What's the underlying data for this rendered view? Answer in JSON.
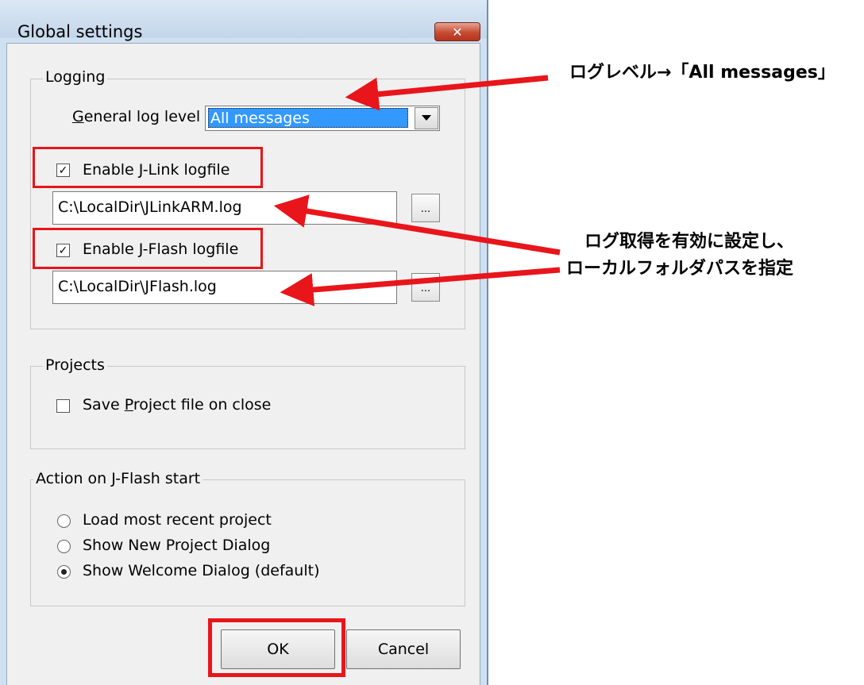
{
  "dialog": {
    "title": "Global settings",
    "close_glyph": "✕"
  },
  "logging": {
    "group_label": "Logging",
    "log_level_label_prefix": "G",
    "log_level_label_rest": "eneral log level",
    "log_level_value": "All messages",
    "jlink_checkbox": {
      "checked": true,
      "label_prefix": "Enable ",
      "label_access": "J",
      "label_rest": "-Link logfile"
    },
    "jlink_path": "C:\\LocalDir\\JLinkARM.log",
    "jflash_checkbox": {
      "checked": true,
      "label": "Enable J-Flash logfile"
    },
    "jflash_path": "C:\\LocalDir\\JFlash.log",
    "browse_label": "..."
  },
  "projects": {
    "group_label": "Projects",
    "save_checkbox": {
      "checked": false,
      "label_prefix": "Save ",
      "label_access": "P",
      "label_rest": "roject file on close"
    }
  },
  "startup": {
    "group_label": "Action on J-Flash start",
    "options": [
      {
        "label": "Load most recent project",
        "selected": false
      },
      {
        "label": "Show New Project Dialog",
        "selected": false
      },
      {
        "label": "Show Welcome Dialog (default)",
        "selected": true
      }
    ]
  },
  "buttons": {
    "ok": "OK",
    "cancel": "Cancel"
  },
  "annotations": {
    "log_level_note": "ログレベル→「All messages」",
    "logfile_note_line1": "ログ取得を有効に設定し、",
    "logfile_note_line2": "ローカルフォルダパスを指定"
  },
  "colors": {
    "highlight_red": "#e8151b",
    "selection_blue": "#3399ff"
  }
}
